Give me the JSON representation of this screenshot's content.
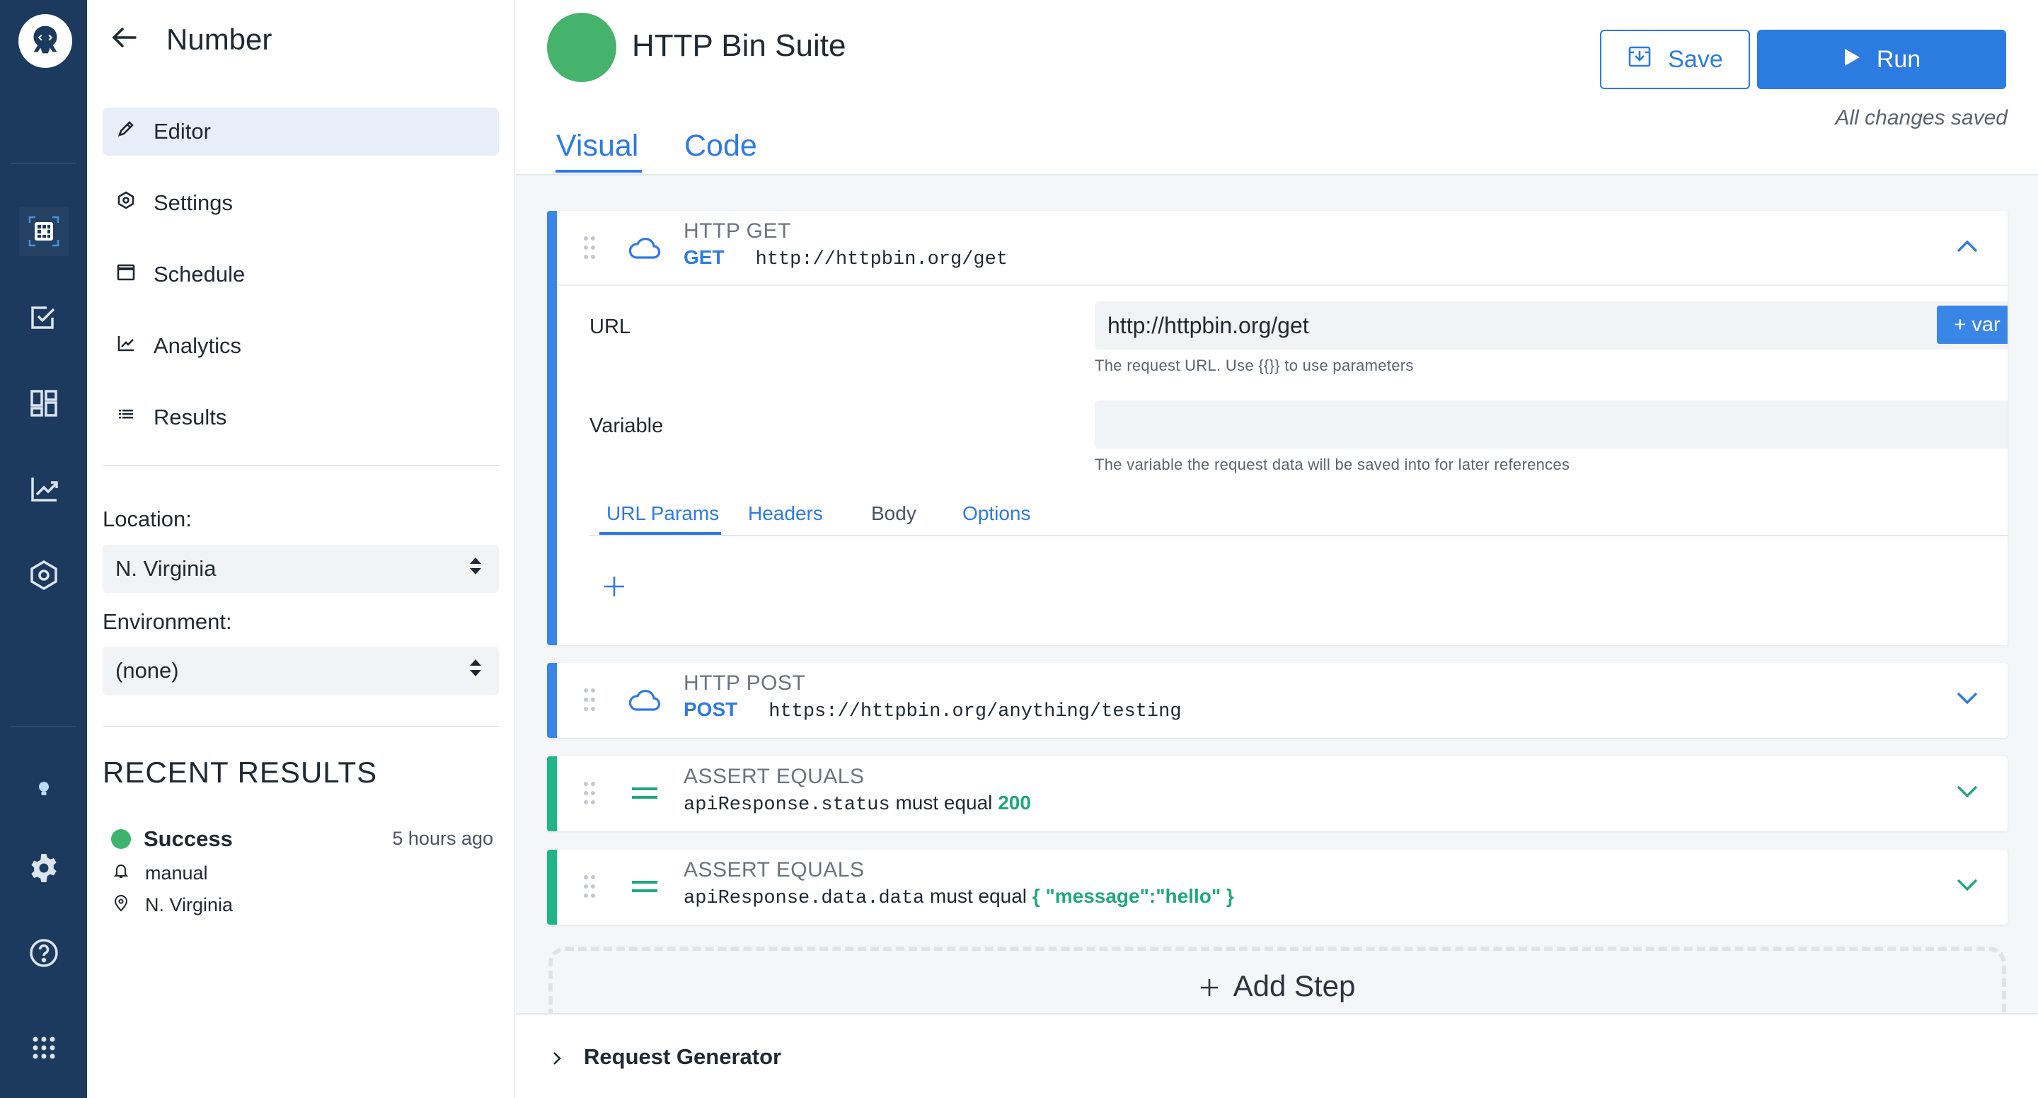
{
  "colors": {
    "rail_bg": "#1c3a5e",
    "accent_blue": "#2d7be2",
    "success_green": "#3eb370",
    "assert_green": "#1fa97a"
  },
  "rail": {
    "logo_icon": "octopus-logo-icon",
    "icons": [
      "tests-grid-icon",
      "checklist-icon",
      "dashboard-icon",
      "analytics-chart-icon",
      "hexagon-settings-icon",
      "lightbulb-icon",
      "gear-icon",
      "help-circle-icon",
      "apps-grid-icon"
    ]
  },
  "sidebar": {
    "title": "Number",
    "nav": [
      {
        "label": "Editor",
        "icon": "pencil-icon",
        "active": true
      },
      {
        "label": "Settings",
        "icon": "settings-hex-icon"
      },
      {
        "label": "Schedule",
        "icon": "calendar-icon"
      },
      {
        "label": "Analytics",
        "icon": "line-chart-icon"
      },
      {
        "label": "Results",
        "icon": "list-icon"
      }
    ],
    "location_label": "Location:",
    "location_value": "N. Virginia",
    "environment_label": "Environment:",
    "environment_value": "(none)",
    "recent_title": "RECENT RESULTS",
    "recent": {
      "status": "Success",
      "time": "5 hours ago",
      "trigger": "manual",
      "location": "N. Virginia"
    }
  },
  "header": {
    "suite_title": "HTTP Bin Suite",
    "save_label": "Save",
    "run_label": "Run",
    "saved_status": "All changes saved",
    "tabs": [
      "Visual",
      "Code"
    ]
  },
  "steps": [
    {
      "type": "HTTP GET",
      "method": "GET",
      "url": "http://httpbin.org/get",
      "expanded": true,
      "form": {
        "url_label": "URL",
        "url_value": "http://httpbin.org/get",
        "var_button": "+ var",
        "url_hint": "The request URL. Use {{}} to use parameters",
        "variable_label": "Variable",
        "variable_value": "",
        "variable_hint": "The variable the request data will be saved into for later references",
        "subtabs": [
          "URL Params",
          "Headers",
          "Body",
          "Options"
        ]
      }
    },
    {
      "type": "HTTP POST",
      "method": "POST",
      "url": "https://httpbin.org/anything/testing"
    },
    {
      "type": "ASSERT EQUALS",
      "subject": "apiResponse.status",
      "op": "must equal",
      "value": "200"
    },
    {
      "type": "ASSERT EQUALS",
      "subject": "apiResponse.data.data",
      "op": "must equal",
      "value": "{ \"message\":\"hello\" }"
    }
  ],
  "add_step_label": "Add Step",
  "request_generator_label": "Request Generator"
}
